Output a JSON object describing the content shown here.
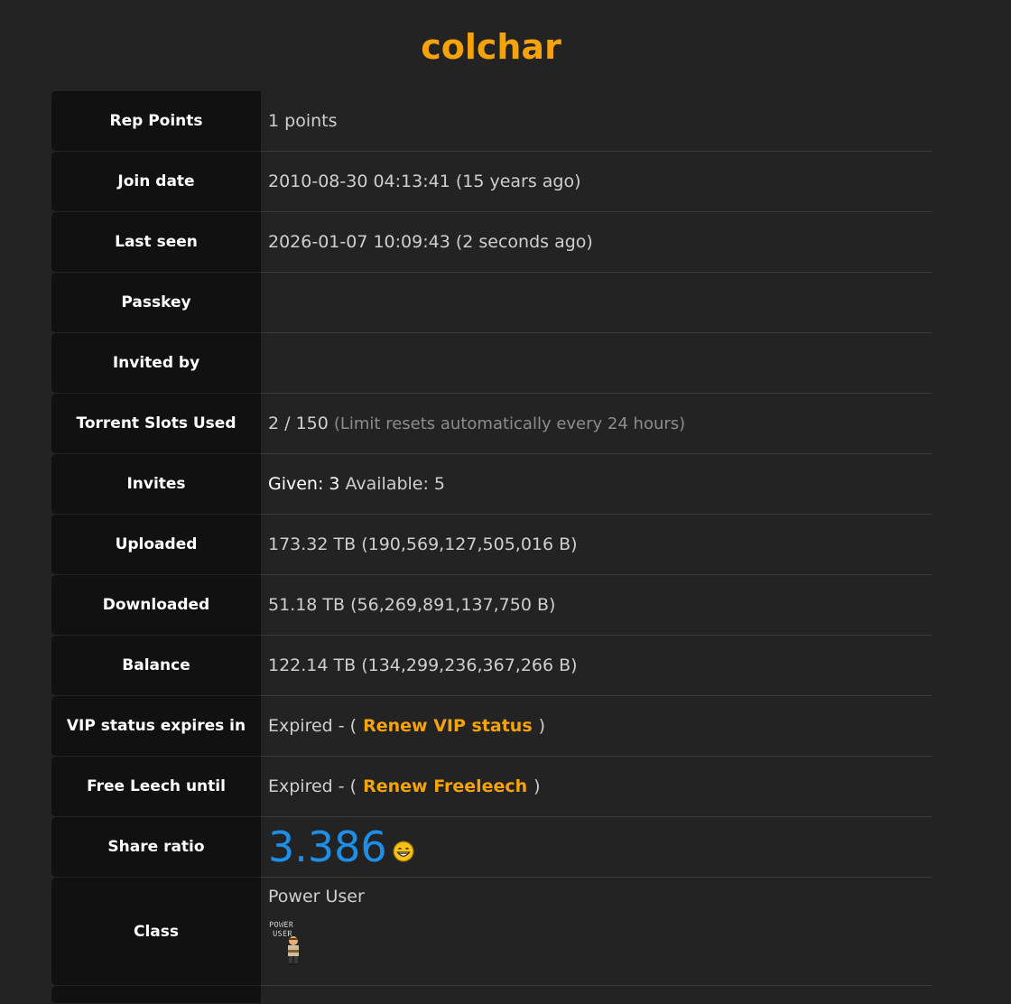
{
  "profile": {
    "username": "colchar",
    "rows": {
      "rep": {
        "label": "Rep Points",
        "value": "1 points"
      },
      "join": {
        "label": "Join date",
        "value": "2010-08-30 04:13:41 (15 years ago)"
      },
      "last_seen": {
        "label": "Last seen",
        "value": "2026-01-07 10:09:43 (2 seconds ago)"
      },
      "passkey": {
        "label": "Passkey",
        "value": ""
      },
      "invited_by": {
        "label": "Invited by",
        "value": ""
      },
      "slots": {
        "label": "Torrent Slots Used",
        "value": "2 / 150",
        "note": "(Limit resets automatically every 24 hours)"
      },
      "invites": {
        "label": "Invites",
        "given_label": "Given:",
        "given": "3",
        "available_label": "Available:",
        "available": "5"
      },
      "uploaded": {
        "label": "Uploaded",
        "value": "173.32 TB (190,569,127,505,016 B)"
      },
      "downloaded": {
        "label": "Downloaded",
        "value": "51.18 TB (56,269,891,137,750 B)"
      },
      "balance": {
        "label": "Balance",
        "value": "122.14 TB (134,299,236,367,266 B)"
      },
      "vip": {
        "label": "VIP status expires in",
        "prefix": "Expired - (",
        "link": "Renew VIP status",
        "suffix": ")"
      },
      "freeleech": {
        "label": "Free Leech until",
        "prefix": "Expired - (",
        "link": "Renew Freeleech",
        "suffix": ")"
      },
      "ratio": {
        "label": "Share ratio",
        "value": "3.386",
        "icon": "grin-smiley-icon"
      },
      "class": {
        "label": "Class",
        "value": "Power User",
        "badge_text": "POWER USER",
        "icon": "power-user-badge-icon"
      }
    }
  },
  "colors": {
    "accent": "#f5a30b",
    "ratio": "#1e8fe8",
    "background": "#232323",
    "label_bg": "#111111"
  }
}
